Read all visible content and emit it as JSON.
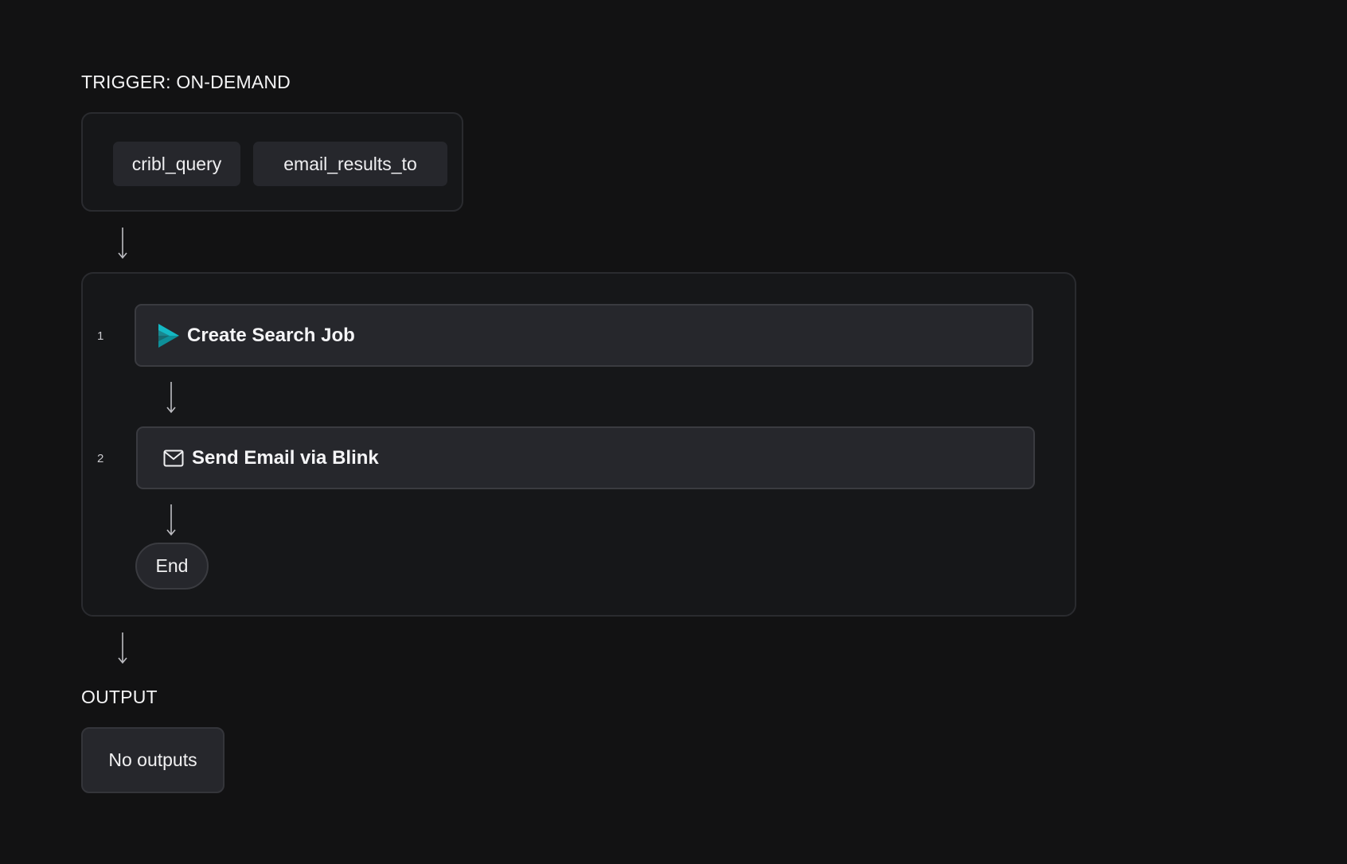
{
  "trigger": {
    "label": "TRIGGER: ON-DEMAND",
    "params": [
      "cribl_query",
      "email_results_to"
    ]
  },
  "steps": [
    {
      "number": "1",
      "title": "Create Search Job",
      "icon": "cribl-search-icon",
      "icon_color": "#14b8c4"
    },
    {
      "number": "2",
      "title": "Send Email via Blink",
      "icon": "mail-icon"
    }
  ],
  "end_label": "End",
  "output": {
    "label": "OUTPUT",
    "empty_text": "No outputs"
  },
  "colors": {
    "background": "#121213",
    "card": "#26272c",
    "border": "#2a2b2f",
    "accent": "#14b8c4"
  }
}
